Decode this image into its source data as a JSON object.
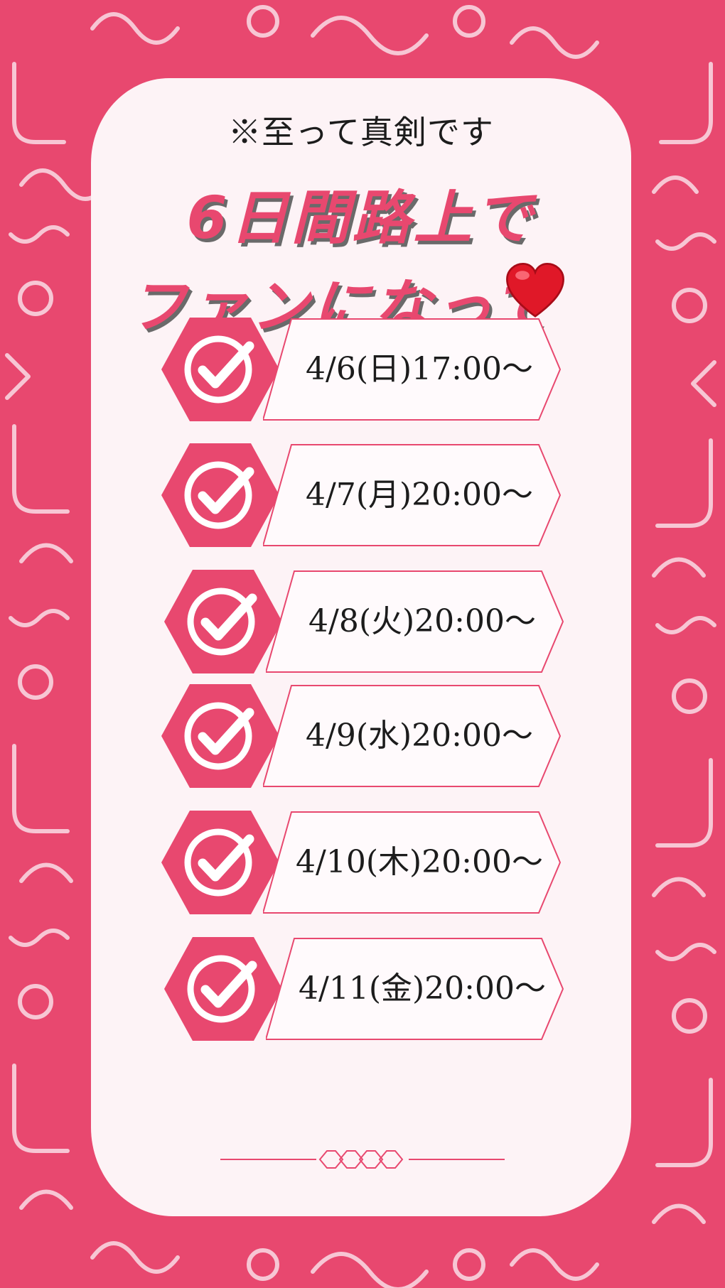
{
  "notice": "※至って真剣です",
  "headline": {
    "line1": "6日間路上で",
    "line2": "ファンになって"
  },
  "icons": {
    "heart": "heart-icon",
    "check": "checkmark-circle-icon"
  },
  "schedule": [
    {
      "label": "4/6(日)17:00〜"
    },
    {
      "label": "4/7(月)20:00〜"
    },
    {
      "label": "4/8(火)20:00〜"
    },
    {
      "label": "4/9(水)20:00〜"
    },
    {
      "label": "4/10(木)20:00〜"
    },
    {
      "label": "4/11(金)20:00〜"
    }
  ],
  "colors": {
    "accent": "#e8486f",
    "card": "#fdf3f6",
    "pattern": "#f7c6d4",
    "text": "#1c1c1c"
  }
}
